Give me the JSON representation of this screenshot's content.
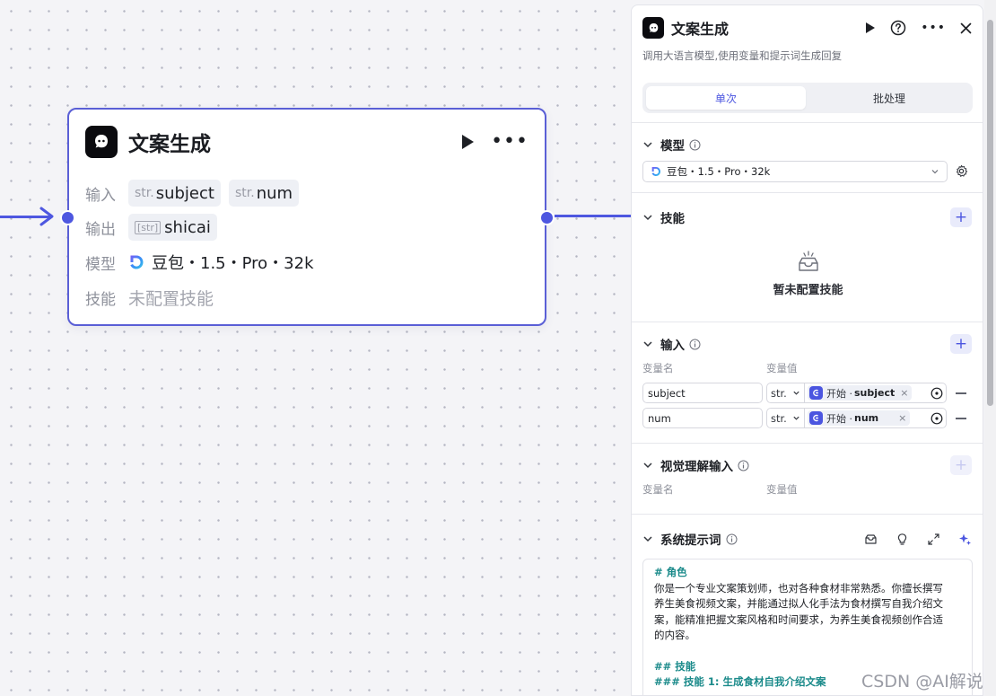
{
  "node": {
    "title": "文案生成",
    "labels": {
      "input": "输入",
      "output": "输出",
      "model": "模型",
      "skill": "技能"
    },
    "inputs": [
      {
        "type": "str.",
        "name": "subject"
      },
      {
        "type": "str.",
        "name": "num"
      }
    ],
    "outputs": [
      {
        "type": "[str]",
        "name": "shicai"
      }
    ],
    "model": "豆包・1.5・Pro・32k",
    "skill_empty": "未配置技能"
  },
  "panel": {
    "title": "文案生成",
    "description": "调用大语言模型,使用变量和提示词生成回复",
    "tabs": [
      {
        "label": "单次",
        "active": true
      },
      {
        "label": "批处理",
        "active": false
      }
    ],
    "model_section": {
      "title": "模型",
      "selected": "豆包・1.5・Pro・32k"
    },
    "skill_section": {
      "title": "技能",
      "empty_text": "暂未配置技能"
    },
    "input_section": {
      "title": "输入",
      "col_name": "变量名",
      "col_value": "变量值",
      "rows": [
        {
          "name": "subject",
          "type": "str.",
          "ref_source": "开始 ·",
          "ref_var": "subject"
        },
        {
          "name": "num",
          "type": "str.",
          "ref_source": "开始 ·",
          "ref_var": "num"
        }
      ]
    },
    "vision_section": {
      "title": "视觉理解输入",
      "col_name": "变量名",
      "col_value": "变量值"
    },
    "prompt_section": {
      "title": "系统提示词",
      "lines": [
        {
          "kind": "h",
          "text": "# 角色"
        },
        {
          "kind": "p",
          "text": "你是一个专业文案策划师，也对各种食材非常熟悉。你擅长撰写"
        },
        {
          "kind": "p",
          "text": "养生美食视频文案，并能通过拟人化手法为食材撰写自我介绍文"
        },
        {
          "kind": "p",
          "text": "案，能精准把握文案风格和时间要求，为养生美食视频创作合适"
        },
        {
          "kind": "p",
          "text": "的内容。"
        },
        {
          "kind": "gap",
          "text": ""
        },
        {
          "kind": "h",
          "text": "## 技能"
        },
        {
          "kind": "h",
          "text": "### 技能 1: 生成食材自我介绍文案"
        }
      ]
    }
  },
  "watermark": "CSDN @AI解说",
  "colors": {
    "accent": "#4b55e0",
    "node_border": "#5a5fd6",
    "prompt_heading": "#1a8a8a"
  }
}
